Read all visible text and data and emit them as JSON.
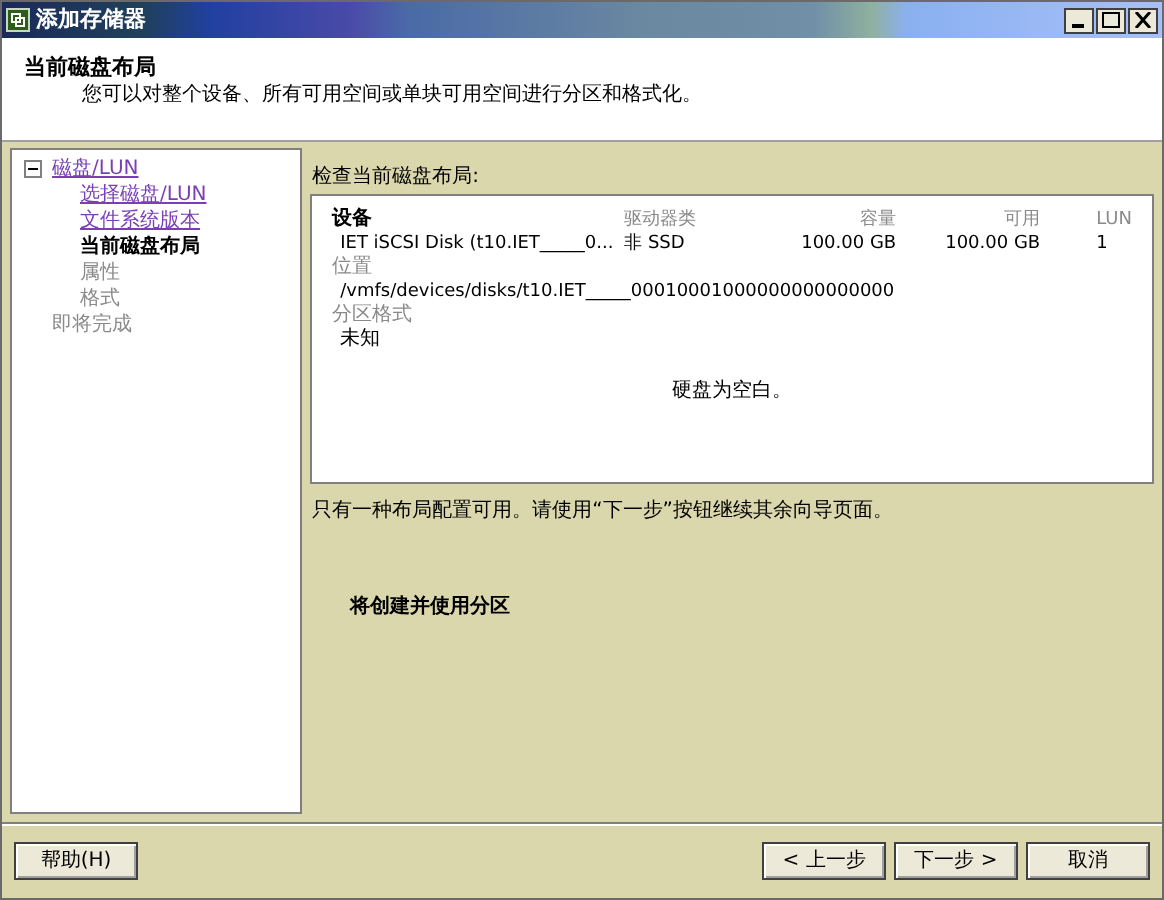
{
  "window": {
    "title": "添加存储器"
  },
  "header": {
    "title": "当前磁盘布局",
    "subtitle": "您可以对整个设备、所有可用空间或单块可用空间进行分区和格式化。"
  },
  "sidebar": {
    "items": [
      {
        "label": "磁盘/LUN",
        "kind": "visited",
        "expanded": true,
        "children": [
          {
            "label": "选择磁盘/LUN",
            "kind": "visited"
          },
          {
            "label": "文件系统版本",
            "kind": "visited"
          },
          {
            "label": "当前磁盘布局",
            "kind": "current"
          },
          {
            "label": "属性",
            "kind": "pending"
          },
          {
            "label": "格式",
            "kind": "pending"
          }
        ]
      },
      {
        "label": "即将完成",
        "kind": "pending"
      }
    ]
  },
  "layout_panel": {
    "label": "检查当前磁盘布局:",
    "columns": [
      "设备",
      "驱动器类",
      "容量",
      "可用",
      "LUN"
    ],
    "row": [
      "IET iSCSI Disk (t10.IET_____0...",
      "非 SSD",
      "100.00 GB",
      "100.00 GB",
      "1"
    ],
    "location_label": "位置",
    "location": "/vmfs/devices/disks/t10.IET_____00010001000000000000000",
    "format_label": "分区格式",
    "format": "未知",
    "empty_message": "硬盘为空白。"
  },
  "note": "只有一种布局配置可用。请使用“下一步”按钮继续其余向导页面。",
  "action": "将创建并使用分区",
  "buttons": {
    "help": "帮助(H)",
    "back": "< 上一步",
    "next": "下一步 >",
    "cancel": "取消"
  }
}
